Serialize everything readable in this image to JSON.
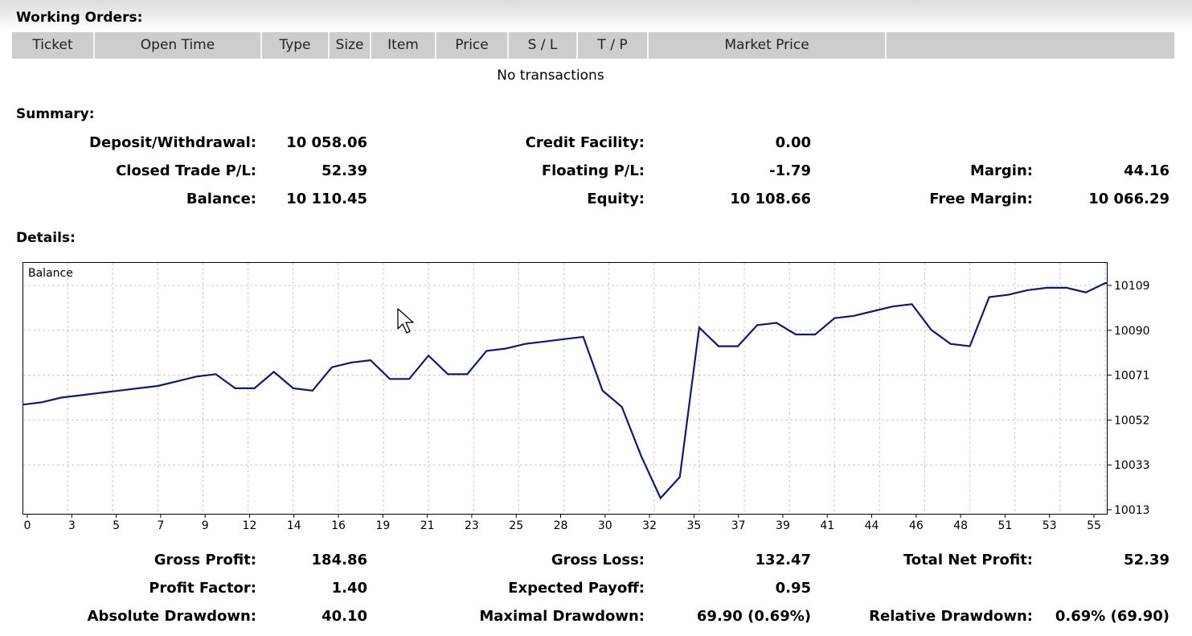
{
  "working_orders": {
    "title": "Working Orders:",
    "columns": [
      "Ticket",
      "Open Time",
      "Type",
      "Size",
      "Item",
      "Price",
      "S / L",
      "T / P",
      "Market Price",
      ""
    ],
    "empty_text": "No transactions"
  },
  "summary": {
    "title": "Summary:",
    "deposit_label": "Deposit/Withdrawal:",
    "deposit_value": "10 058.06",
    "credit_label": "Credit Facility:",
    "credit_value": "0.00",
    "closed_pl_label": "Closed Trade P/L:",
    "closed_pl_value": "52.39",
    "floating_pl_label": "Floating P/L:",
    "floating_pl_value": "-1.79",
    "margin_label": "Margin:",
    "margin_value": "44.16",
    "balance_label": "Balance:",
    "balance_value": "10 110.45",
    "equity_label": "Equity:",
    "equity_value": "10 108.66",
    "free_margin_label": "Free Margin:",
    "free_margin_value": "10 066.29"
  },
  "details": {
    "title": "Details:",
    "gross_profit_label": "Gross Profit:",
    "gross_profit_value": "184.86",
    "gross_loss_label": "Gross Loss:",
    "gross_loss_value": "132.47",
    "total_net_profit_label": "Total Net Profit:",
    "total_net_profit_value": "52.39",
    "profit_factor_label": "Profit Factor:",
    "profit_factor_value": "1.40",
    "expected_payoff_label": "Expected Payoff:",
    "expected_payoff_value": "0.95",
    "absolute_drawdown_label": "Absolute Drawdown:",
    "absolute_drawdown_value": "40.10",
    "maximal_drawdown_label": "Maximal Drawdown:",
    "maximal_drawdown_value": "69.90 (0.69%)",
    "relative_drawdown_label": "Relative Drawdown:",
    "relative_drawdown_value": "0.69% (69.90)"
  },
  "colors": {
    "line": "#101a6b",
    "grid": "#c8c8c8",
    "header": "#cdcdcd"
  },
  "chart_data": {
    "type": "line",
    "title": "Balance",
    "x_ticks": [
      "0",
      "3",
      "5",
      "7",
      "9",
      "12",
      "14",
      "16",
      "19",
      "21",
      "23",
      "25",
      "28",
      "30",
      "32",
      "35",
      "37",
      "39",
      "41",
      "44",
      "46",
      "48",
      "51",
      "53",
      "55"
    ],
    "y_ticks": [
      "10109",
      "10090",
      "10071",
      "10052",
      "10033",
      "10013"
    ],
    "xlim": [
      0,
      56
    ],
    "ylim": [
      10013,
      10109
    ],
    "grid": true,
    "series": [
      {
        "values": [
          [
            0,
            10058
          ],
          [
            1,
            10059
          ],
          [
            2,
            10061
          ],
          [
            3,
            10062
          ],
          [
            4,
            10063
          ],
          [
            5,
            10064
          ],
          [
            6,
            10065
          ],
          [
            7,
            10066
          ],
          [
            8,
            10068
          ],
          [
            9,
            10070
          ],
          [
            10,
            10071
          ],
          [
            11,
            10065
          ],
          [
            12,
            10065
          ],
          [
            13,
            10072
          ],
          [
            14,
            10065
          ],
          [
            15,
            10064
          ],
          [
            16,
            10074
          ],
          [
            17,
            10076
          ],
          [
            18,
            10077
          ],
          [
            19,
            10069
          ],
          [
            20,
            10069
          ],
          [
            21,
            10079
          ],
          [
            22,
            10071
          ],
          [
            23,
            10071
          ],
          [
            24,
            10081
          ],
          [
            25,
            10082
          ],
          [
            26,
            10084
          ],
          [
            27,
            10085
          ],
          [
            28,
            10086
          ],
          [
            29,
            10087
          ],
          [
            30,
            10064
          ],
          [
            31,
            10057
          ],
          [
            32,
            10036
          ],
          [
            33,
            10018
          ],
          [
            34,
            10027
          ],
          [
            35,
            10091
          ],
          [
            36,
            10083
          ],
          [
            37,
            10083
          ],
          [
            38,
            10092
          ],
          [
            39,
            10093
          ],
          [
            40,
            10088
          ],
          [
            41,
            10088
          ],
          [
            42,
            10095
          ],
          [
            43,
            10096
          ],
          [
            44,
            10098
          ],
          [
            45,
            10100
          ],
          [
            46,
            10101
          ],
          [
            47,
            10090
          ],
          [
            48,
            10084
          ],
          [
            49,
            10083
          ],
          [
            50,
            10104
          ],
          [
            51,
            10105
          ],
          [
            52,
            10107
          ],
          [
            53,
            10108
          ],
          [
            54,
            10108
          ],
          [
            55,
            10106
          ],
          [
            56,
            10110
          ],
          [
            57,
            10110
          ]
        ]
      }
    ]
  }
}
